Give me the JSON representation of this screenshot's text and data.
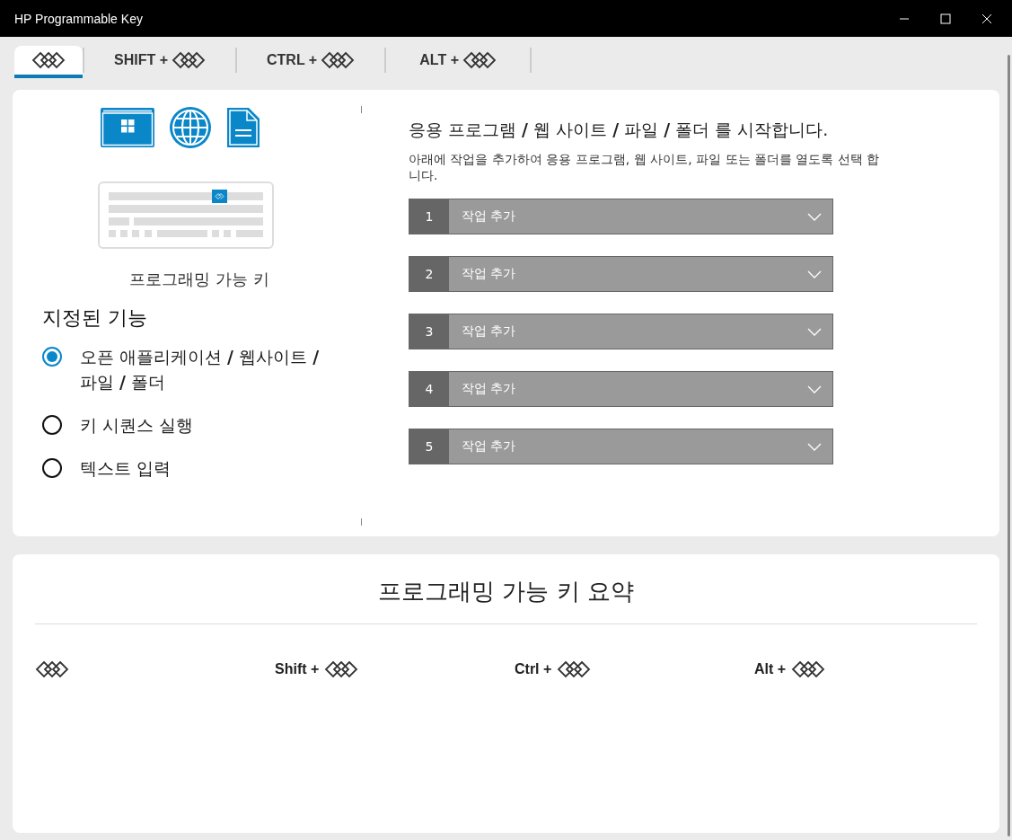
{
  "window": {
    "title": "HP Programmable Key"
  },
  "tabs": [
    {
      "selected": true
    },
    {
      "label": "SHIFT +",
      "selected": false
    },
    {
      "label": "CTRL +",
      "selected": false
    },
    {
      "label": "ALT +",
      "selected": false
    }
  ],
  "left_panel": {
    "caption": "프로그래밍 가능 키",
    "heading": "지정된 기능",
    "options": [
      {
        "label": "오픈 애플리케이션 **/** 웹사이트 **/** 파일 **/** 폴더",
        "selected": true
      },
      {
        "label": "키 시퀀스 실행",
        "selected": false
      },
      {
        "label": "텍스트 입력",
        "selected": false
      }
    ]
  },
  "right_panel": {
    "heading": "응용 프로그램 **/** 웹 사이트 **/** 파일 **/** 폴더 를 시작합니다.",
    "description": "아래에 작업을 추가하여 응용 프로그램, 웹 사이트, 파일 또는 폴더를 열도록 선택 합니다.",
    "actions": [
      {
        "number": "1",
        "value": "작업 추가"
      },
      {
        "number": "2",
        "value": "작업 추가"
      },
      {
        "number": "3",
        "value": "작업 추가"
      },
      {
        "number": "4",
        "value": "작업 추가"
      },
      {
        "number": "5",
        "value": "작업 추가"
      }
    ]
  },
  "summary": {
    "title": "프로그래밍 가능 키 요약",
    "columns": [
      {},
      {
        "label": "Shift +"
      },
      {
        "label": "Ctrl +"
      },
      {
        "label": "Alt +"
      }
    ]
  }
}
